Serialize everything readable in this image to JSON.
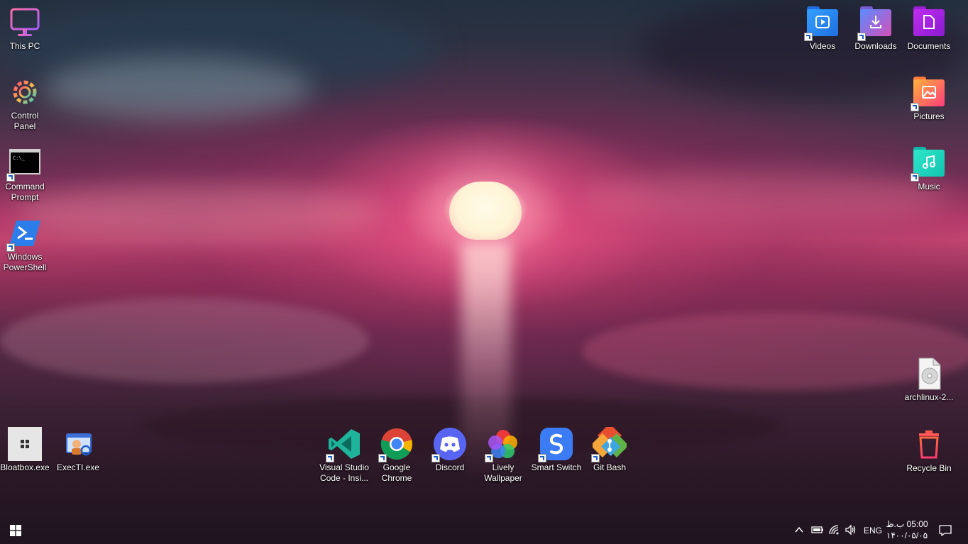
{
  "desktop": {
    "left_icons": [
      {
        "label": "This PC",
        "icon": "monitor-icon"
      },
      {
        "label": "Control\nPanel",
        "icon": "settings-gear-icon"
      },
      {
        "label": "Command\nPrompt",
        "icon": "terminal-icon"
      },
      {
        "label": "Windows\nPowerShell",
        "icon": "powershell-icon"
      }
    ],
    "right_icons": [
      {
        "label": "Videos",
        "icon": "videos-folder-icon",
        "color": "#2f8bff"
      },
      {
        "label": "Downloads",
        "icon": "downloads-folder-icon",
        "color": "#c14bd6"
      },
      {
        "label": "Documents",
        "icon": "documents-folder-icon",
        "color": "#b02ae8"
      },
      {
        "label": "Pictures",
        "icon": "pictures-folder-icon",
        "color": "#ff5a7a"
      },
      {
        "label": "Music",
        "icon": "music-folder-icon",
        "color": "#18d6c2"
      },
      {
        "label": "archlinux-2...",
        "icon": "disc-image-file-icon"
      },
      {
        "label": "Recycle Bin",
        "icon": "recycle-bin-icon"
      }
    ],
    "bottom_left_icons": [
      {
        "label": "Bloatbox.exe",
        "icon": "bloatbox-icon"
      },
      {
        "label": "ExecTI.exe",
        "icon": "execti-icon"
      }
    ],
    "bottom_center_icons": [
      {
        "label": "Visual Studio\nCode - Insi...",
        "icon": "vscode-icon"
      },
      {
        "label": "Google\nChrome",
        "icon": "chrome-icon"
      },
      {
        "label": "Discord",
        "icon": "discord-icon"
      },
      {
        "label": "Lively\nWallpaper",
        "icon": "lively-icon"
      },
      {
        "label": "Smart Switch",
        "icon": "smart-switch-icon"
      },
      {
        "label": "Git Bash",
        "icon": "git-bash-icon"
      }
    ]
  },
  "taskbar": {
    "language": "ENG",
    "time": "05:00 ب.ظ",
    "date": "۱۴۰۰/۰۵/۰۵",
    "tray_icons": [
      "chevron-up-icon",
      "battery-icon",
      "wifi-icon",
      "volume-icon"
    ]
  },
  "colors": {
    "accent": "#c2456f",
    "sun": "#fff4d6"
  }
}
